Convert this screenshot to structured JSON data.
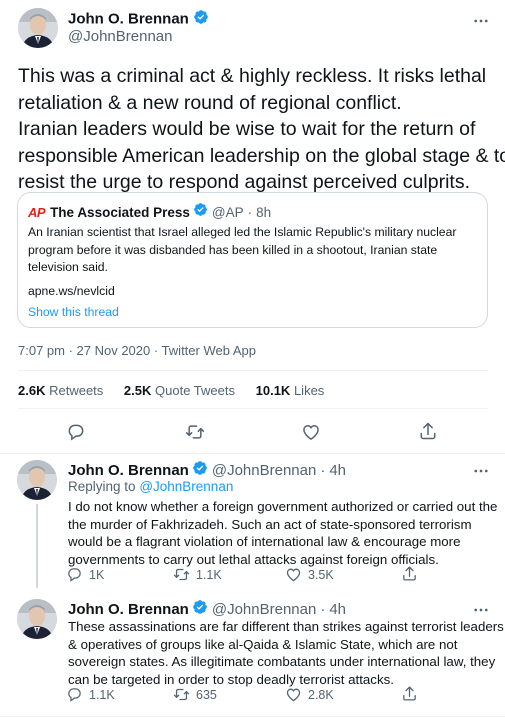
{
  "main_tweet": {
    "author_name": "John O. Brennan",
    "author_handle": "@JohnBrennan",
    "more_icon": "more-horizontal-icon",
    "text_line_1": "This was a criminal act & highly reckless. It risks lethal",
    "text_line_2": "retaliation & a new round of regional conflict.",
    "text_line_3": "Iranian leaders would be wise to wait for the return of",
    "text_line_4": "responsible American leadership on the global stage & to",
    "text_line_5": "resist the urge to respond against perceived culprits.",
    "quoted": {
      "logo_text": "AP",
      "name": "The Associated Press",
      "handle": "@AP",
      "dot": "·",
      "time": "8h",
      "text_line_1": "An Iranian scientist that Israel alleged led the Islamic Republic's military nuclear",
      "text_line_2": "program before it was disbanded has been killed in a shootout, Iranian state",
      "text_line_3": "television said.",
      "link": "apne.ws/nevlcid",
      "show_thread": "Show this thread"
    },
    "timestamp": "7:07 pm · 27 Nov 2020 · Twitter Web App",
    "stats": {
      "retweets_value": "2.6K",
      "retweets_label": "Retweets",
      "quotes_value": "2.5K",
      "quotes_label": "Quote Tweets",
      "likes_value": "10.1K",
      "likes_label": "Likes"
    }
  },
  "replies": [
    {
      "author_name": "John O. Brennan",
      "author_handle": "@JohnBrennan",
      "dot": "·",
      "time": "4h",
      "replying_prefix": "Replying to",
      "replying_to": "@JohnBrennan",
      "text_line_1": "I do not know whether a foreign government authorized or carried out the",
      "text_line_2": "the murder of Fakhrizadeh. Such an act of state-sponsored terrorism",
      "text_line_3": "would be a flagrant violation of international law & encourage more",
      "text_line_4": "governments to carry out lethal attacks against foreign officials.",
      "replies_count": "1K",
      "retweets_count": "1.1K",
      "likes_count": "3.5K"
    },
    {
      "author_name": "John O. Brennan",
      "author_handle": "@JohnBrennan",
      "dot": "·",
      "time": "4h",
      "text_line_1": "These assassinations are far different than strikes against terrorist leaders",
      "text_line_2": "& operatives of groups like al-Qaida & Islamic State, which are not",
      "text_line_3": "sovereign states. As illegitimate combatants under international law, they",
      "text_line_4": "can be targeted in order to stop deadly terrorist attacks.",
      "replies_count": "1.1K",
      "retweets_count": "635",
      "likes_count": "2.8K"
    }
  ],
  "colors": {
    "accent": "#1d9bf0",
    "text": "#0f1419",
    "muted": "#536471",
    "border": "#cfd9de",
    "divider": "#eff3f4",
    "ap_red": "#e2231a"
  }
}
